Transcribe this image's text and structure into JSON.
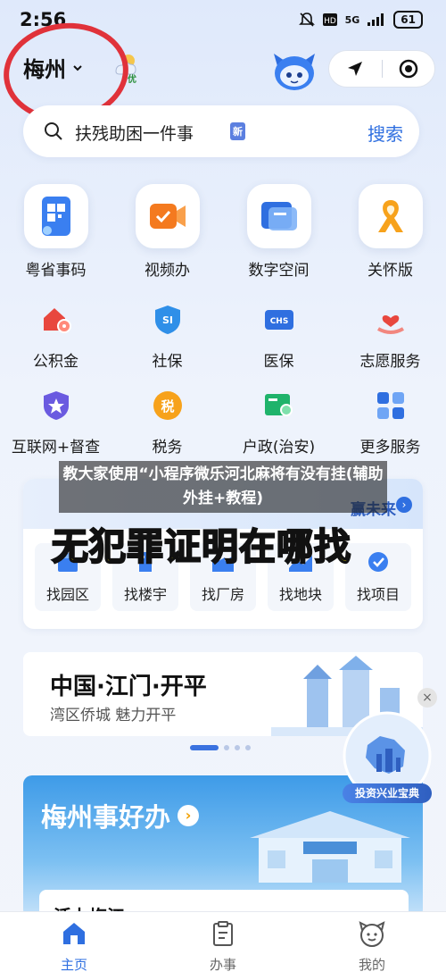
{
  "status_bar": {
    "time": "2:56",
    "network": "5G",
    "battery": "61"
  },
  "header": {
    "city": "梅州",
    "weather_quality": "优"
  },
  "search": {
    "placeholder": "扶残助困一件事",
    "new_tag": "新",
    "button": "搜索"
  },
  "top_services": [
    {
      "label": "粤省事码",
      "icon": "qr-code-icon"
    },
    {
      "label": "视频办",
      "icon": "video-icon"
    },
    {
      "label": "数字空间",
      "icon": "digital-space-icon"
    },
    {
      "label": "关怀版",
      "icon": "ribbon-icon"
    }
  ],
  "services_row2": [
    {
      "label": "公积金",
      "icon": "house-fund-icon"
    },
    {
      "label": "社保",
      "icon": "social-security-icon"
    },
    {
      "label": "医保",
      "icon": "medical-insurance-icon"
    },
    {
      "label": "志愿服务",
      "icon": "volunteer-icon"
    }
  ],
  "services_row3": [
    {
      "label": "互联网+督查",
      "icon": "inspection-icon"
    },
    {
      "label": "税务",
      "icon": "tax-icon"
    },
    {
      "label": "户政(治安)",
      "icon": "household-icon"
    },
    {
      "label": "更多服务",
      "icon": "more-services-icon"
    }
  ],
  "find_section": {
    "banner_right": "赢未来",
    "buttons": [
      "找园区",
      "找楼宇",
      "找厂房",
      "找地块",
      "找项目"
    ]
  },
  "overlay": {
    "title": "教大家使用“小程序微乐河北麻将有没有挂(辅助外挂+教程)",
    "caption": "无犯罪证明在哪找"
  },
  "promo": {
    "title": "中国·江门·开平",
    "subtitle": "湾区侨城 魅力开平"
  },
  "float_ad": {
    "label": "投资兴业宝典"
  },
  "meizhou": {
    "title": "梅州事好办",
    "inner_title": "活力梅江"
  },
  "tabs": [
    {
      "label": "主页"
    },
    {
      "label": "办事"
    },
    {
      "label": "我的"
    }
  ],
  "colors": {
    "accent": "#2f6fe0",
    "annotation_red": "#e0323a",
    "caption_yellow": "#f5e400"
  }
}
